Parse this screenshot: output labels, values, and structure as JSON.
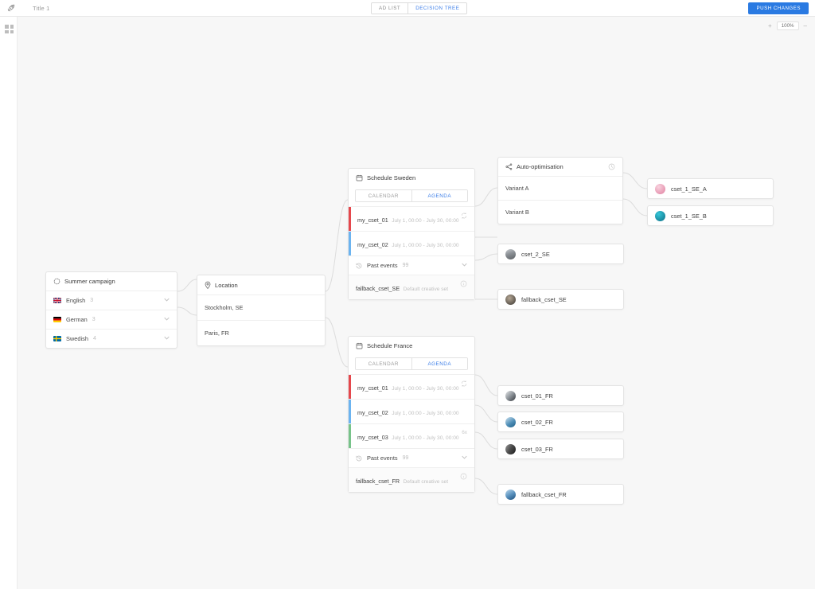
{
  "topbar": {
    "logo_icon": "rocket-icon",
    "doc_title": "Title 1",
    "view_tabs": [
      {
        "label": "AD LIST",
        "active": false
      },
      {
        "label": "DECISION TREE",
        "active": true
      }
    ],
    "push_changes_label": "PUSH CHANGES",
    "accent_color": "#2a7ae2"
  },
  "canvas": {
    "expand_icon": "expand-grid-icon",
    "zoom": {
      "in_label": "+",
      "level": "100%",
      "out_label": "–"
    },
    "background_color": "#f7f7f7"
  },
  "campaign_node": {
    "icon": "audience-icon",
    "title": "Summer campaign",
    "languages": [
      {
        "flag": "flag-uk",
        "label": "English",
        "count": "3"
      },
      {
        "flag": "flag-de",
        "label": "German",
        "count": "3"
      },
      {
        "flag": "flag-se",
        "label": "Swedish",
        "count": "4"
      }
    ]
  },
  "location_node": {
    "icon": "map-pin-icon",
    "title": "Location",
    "locations": [
      {
        "label": "Stockholm, SE"
      },
      {
        "label": "Paris, FR"
      }
    ]
  },
  "schedule_sweden": {
    "icon": "calendar-icon",
    "title": "Schedule Sweden",
    "tabs": [
      {
        "label": "CALENDAR",
        "active": false
      },
      {
        "label": "AGENDA",
        "active": true
      }
    ],
    "events": [
      {
        "name": "my_cset_01",
        "time": "July 1, 00:00 - July 30, 00:00",
        "color": "#e5484d",
        "icon": "repeat-icon",
        "badge": ""
      },
      {
        "name": "my_cset_02",
        "time": "July 1, 00:00 - July 30, 00:00",
        "color": "#6cb4f0",
        "icon": "",
        "badge": ""
      }
    ],
    "past_events": {
      "icon": "history-icon",
      "label": "Past events",
      "count": "99",
      "chevron": "chevron-down-icon"
    },
    "fallback": {
      "name": "fallback_cset_SE",
      "subtitle": "Default creative set",
      "icon": "info-icon"
    }
  },
  "schedule_france": {
    "icon": "calendar-icon",
    "title": "Schedule France",
    "tabs": [
      {
        "label": "CALENDAR",
        "active": false
      },
      {
        "label": "AGENDA",
        "active": true
      }
    ],
    "events": [
      {
        "name": "my_cset_01",
        "time": "July 1, 00:00 - July 30, 00:00",
        "color": "#e5484d",
        "icon": "repeat-icon",
        "badge": ""
      },
      {
        "name": "my_cset_02",
        "time": "July 1, 00:00 - July 30, 00:00",
        "color": "#6cb4f0",
        "icon": "",
        "badge": ""
      },
      {
        "name": "my_cset_03",
        "time": "July 1, 00:00 - July 30, 00:00",
        "color": "#78c38a",
        "icon": "",
        "badge": "6x"
      }
    ],
    "past_events": {
      "icon": "history-icon",
      "label": "Past events",
      "count": "99",
      "chevron": "chevron-down-icon"
    },
    "fallback": {
      "name": "fallback_cset_FR",
      "subtitle": "Default creative set",
      "icon": "info-icon"
    }
  },
  "auto_optimisation": {
    "icon": "split-branch-icon",
    "title": "Auto-optimisation",
    "status_icon": "clock-icon",
    "variants": [
      {
        "label": "Variant A"
      },
      {
        "label": "Variant B"
      }
    ]
  },
  "creative_sets": [
    {
      "id": "cset_1_SE_A",
      "label": "cset_1_SE_A",
      "thumb_colors": [
        "#f3b9c8",
        "#e07fa0"
      ]
    },
    {
      "id": "cset_1_SE_B",
      "label": "cset_1_SE_B",
      "thumb_colors": [
        "#18a5b8",
        "#0d6f86"
      ]
    },
    {
      "id": "cset_2_SE",
      "label": "cset_2_SE",
      "thumb_colors": [
        "#b8bcc0",
        "#6e7276"
      ]
    },
    {
      "id": "fallback_cset_SE",
      "label": "fallback_cset_SE",
      "thumb_colors": [
        "#8c8277",
        "#3a3631"
      ]
    },
    {
      "id": "cset_01_FR",
      "label": "cset_01_FR",
      "thumb_colors": [
        "#d8dadc",
        "#4a4f55"
      ]
    },
    {
      "id": "cset_02_FR",
      "label": "cset_02_FR",
      "thumb_colors": [
        "#9fc8e0",
        "#1f5f86"
      ]
    },
    {
      "id": "cset_03_FR",
      "label": "cset_03_FR",
      "thumb_colors": [
        "#7a7a7a",
        "#242424"
      ]
    },
    {
      "id": "fallback_cset_FR",
      "label": "fallback_cset_FR",
      "thumb_colors": [
        "#9ec9e8",
        "#1d4f7d"
      ]
    }
  ]
}
